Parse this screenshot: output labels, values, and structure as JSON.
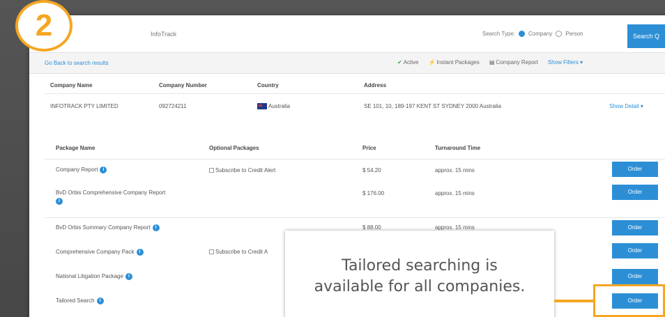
{
  "step_badge": "2",
  "search": {
    "value": "InfoTrack",
    "type_label": "Search Type:",
    "option_company": "Company",
    "option_person": "Person",
    "button_label": "Search Q"
  },
  "subbar": {
    "go_back": "Go Back to search results",
    "legend": {
      "active": "Active",
      "instant": "Instant Packages",
      "company_report": "Company Report",
      "show_filters": "Show Filters"
    }
  },
  "company_table": {
    "headers": {
      "name": "Company Name",
      "number": "Company Number",
      "country": "Country",
      "address": "Address"
    },
    "row": {
      "name": "INFOTRACK PTY LIMITED",
      "number": "092724211",
      "country": "Australia",
      "address": "SE 101, 10, 189-197 KENT ST SYDNEY 2000 Australia",
      "detail": "Show Detail"
    }
  },
  "package_table": {
    "headers": {
      "name": "Package Name",
      "optional": "Optional Packages",
      "price": "Price",
      "turnaround": "Turnaround Time"
    },
    "order_label": "Order",
    "rows": [
      {
        "name": "Company Report",
        "optional": "Subscribe to Credit Alert",
        "price": "$ 54.20",
        "turnaround": "approx. 15 mins"
      },
      {
        "name": "BvD Orbis Comprehensive Company Report",
        "optional": "",
        "price": "$ 176.00",
        "turnaround": "approx. 15 mins"
      },
      {
        "name": "BvD Orbis Summary Company Report",
        "optional": "",
        "price": "$ 88.00",
        "turnaround": "approx. 15 mins"
      },
      {
        "name": "Comprehensive Company Pack",
        "optional": "Subscribe to Credit A",
        "price": "",
        "turnaround": ""
      },
      {
        "name": "National Litigation Package",
        "optional": "",
        "price": "",
        "turnaround": ""
      },
      {
        "name": "Tailored Search",
        "optional": "",
        "price": "",
        "turnaround": ""
      }
    ]
  },
  "callout": {
    "line1": "Tailored searching is",
    "line2": "available for all companies."
  },
  "colors": {
    "accent_orange": "#f5a623",
    "button_blue": "#2c8fd6"
  }
}
